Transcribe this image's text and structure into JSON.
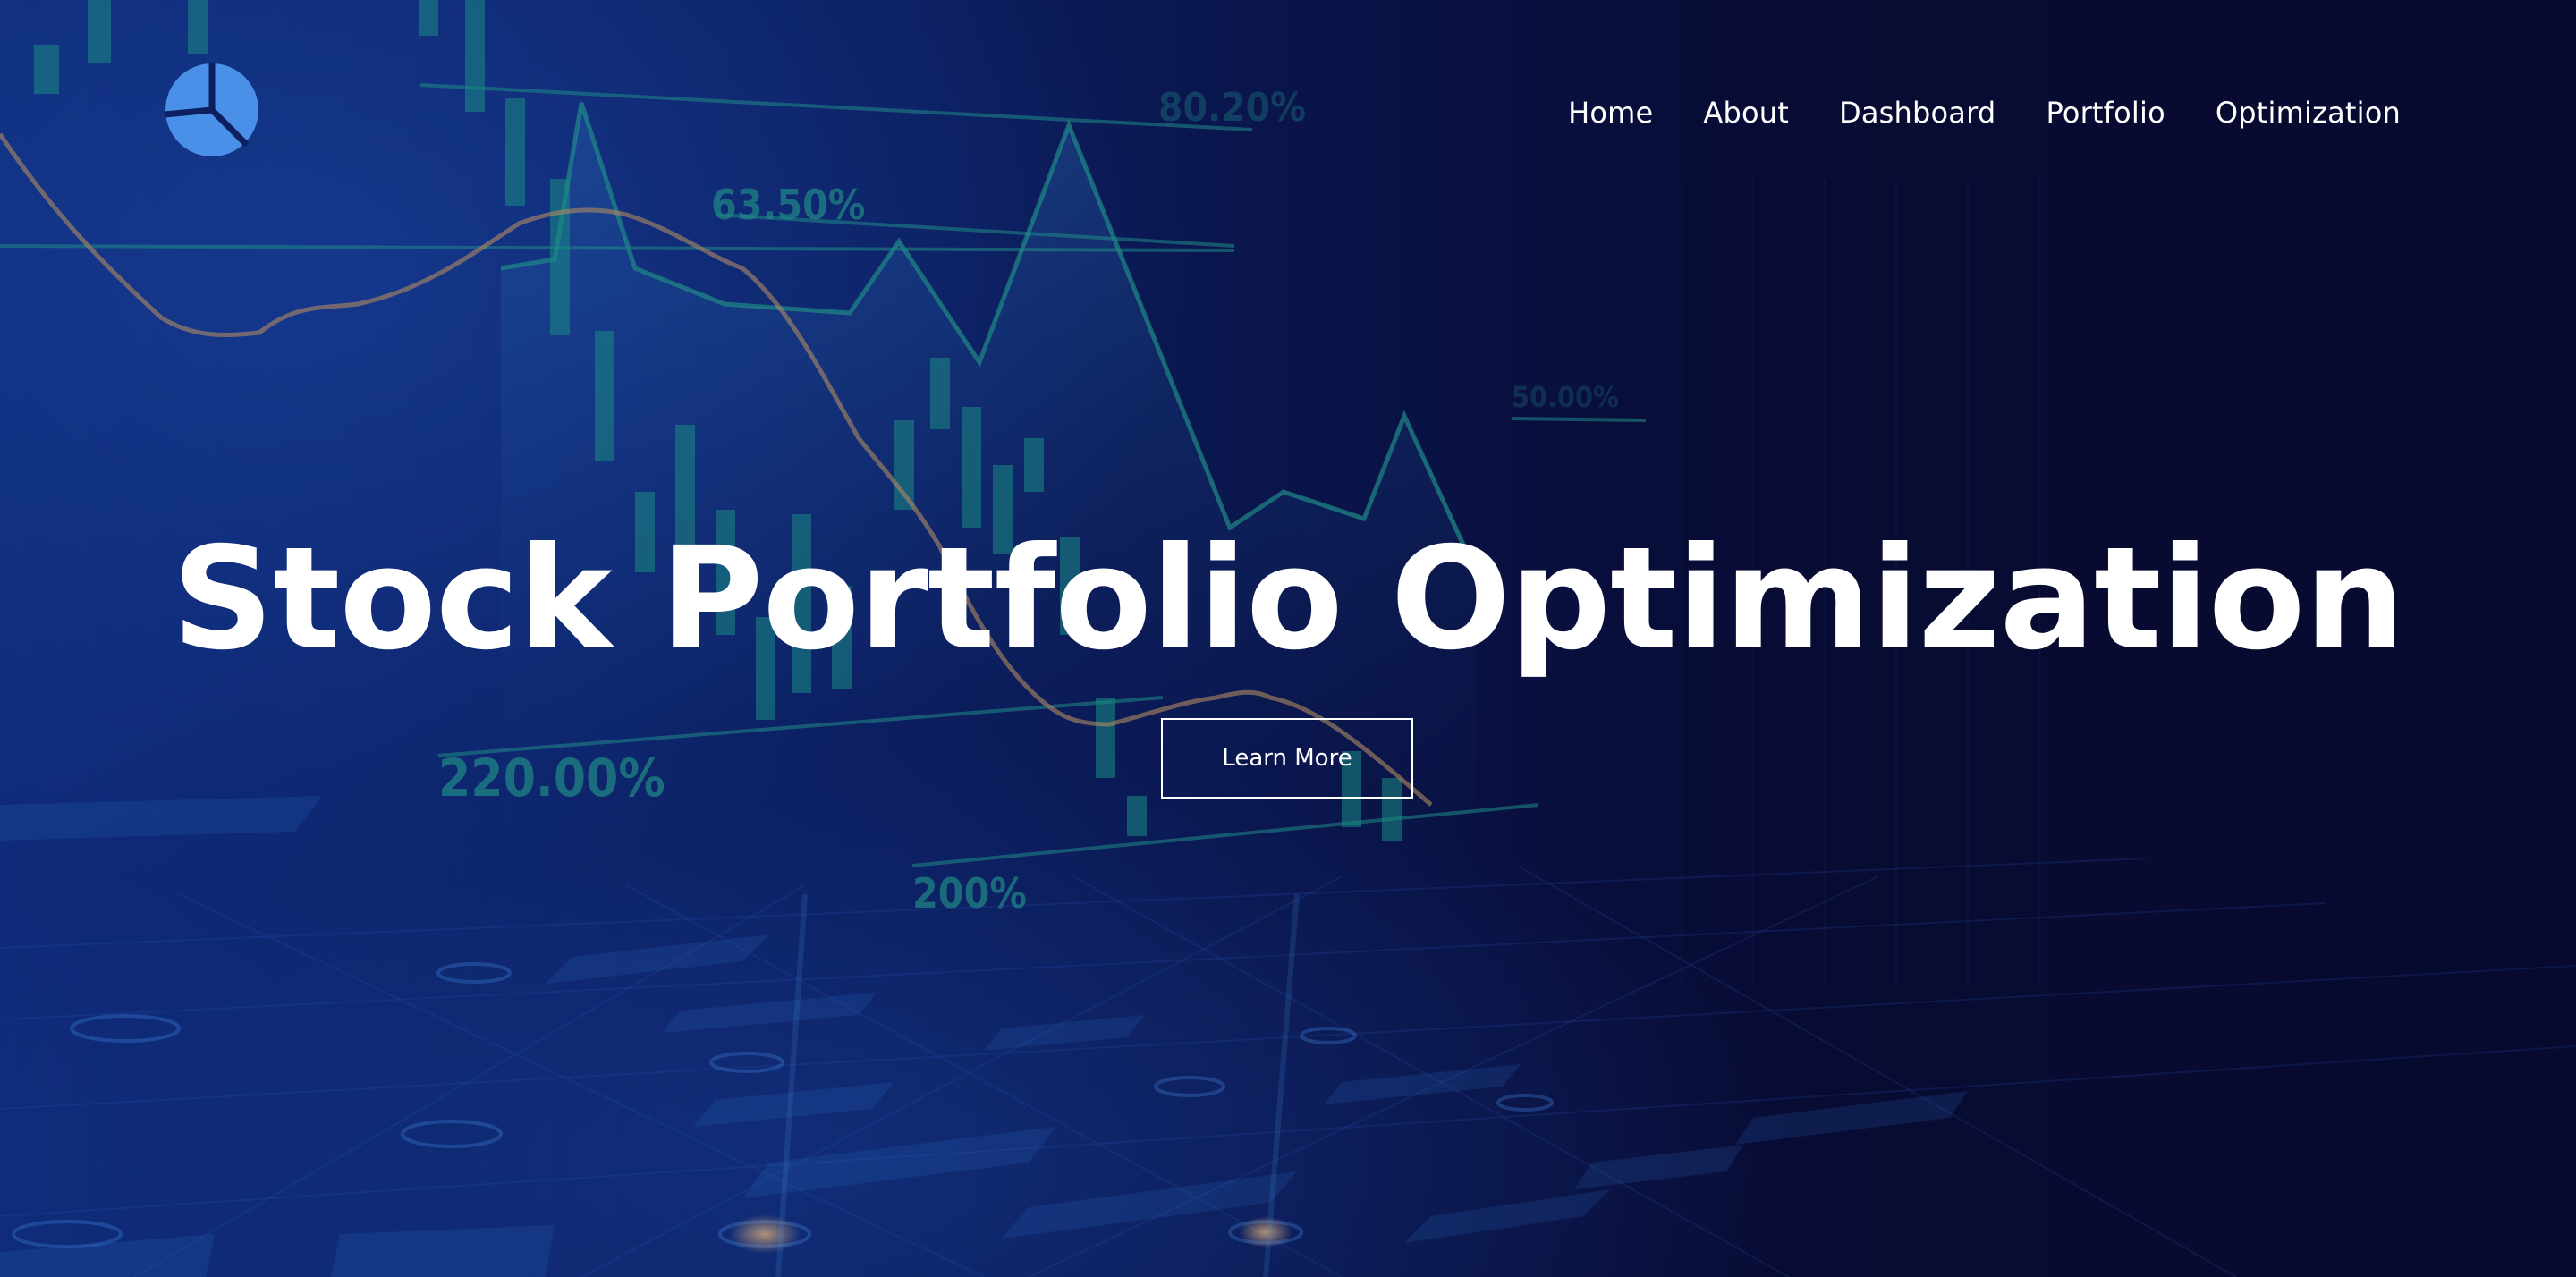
{
  "header": {
    "logo_icon": "pie-chart-icon",
    "nav": [
      {
        "label": "Home"
      },
      {
        "label": "About"
      },
      {
        "label": "Dashboard"
      },
      {
        "label": "Portfolio"
      },
      {
        "label": "Optimization"
      }
    ]
  },
  "hero": {
    "title": "Stock Portfolio Optimization",
    "cta_label": "Learn More",
    "background_labels": [
      "80.20%",
      "63.50%",
      "50.00%",
      "220.00%",
      "200%"
    ]
  },
  "colors": {
    "background_dark": "#080b33",
    "background_blue": "#0e2a78",
    "logo_blue": "#4a8fe8",
    "chart_teal": "#1f7a7a",
    "chart_line_orange": "#9a7a5a",
    "text": "#ffffff"
  }
}
